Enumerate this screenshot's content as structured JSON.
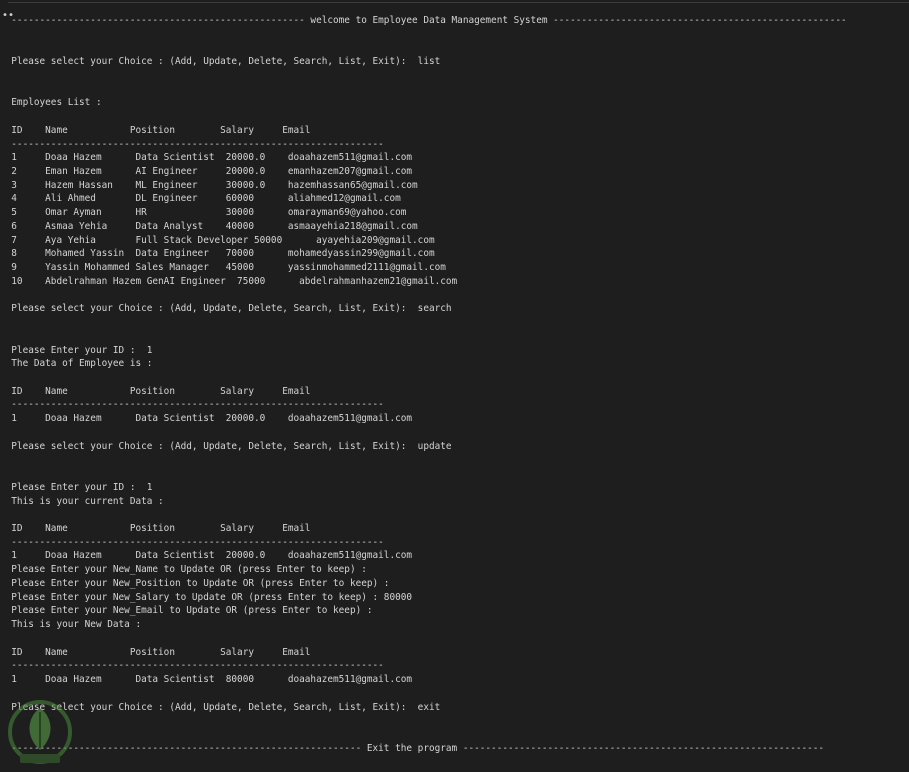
{
  "terminal": {
    "gutter_mark": "••",
    "lines": [
      "  ---------------------------------------------------- welcome to Employee Data Management System ----------------------------------------------------",
      "",
      "",
      "  Please select your Choice : (Add, Update, Delete, Search, List, Exit):  list",
      "",
      "",
      "  Employees List :",
      "",
      "  ID    Name           Position        Salary     Email",
      "  ------------------------------------------------------------------",
      "  1     Doaa Hazem      Data Scientist  20000.0    doaahazem511@gmail.com",
      "  2     Eman Hazem      AI Engineer     20000.0    emanhazem207@gmail.com",
      "  3     Hazem Hassan    ML Engineer     30000.0    hazemhassan65@gmail.com",
      "  4     Ali Ahmed       DL Engineer     60000      aliahmed12@gmail.com",
      "  5     Omar Ayman      HR              30000      omarayman69@yahoo.com",
      "  6     Asmaa Yehia     Data Analyst    40000      asmaayehia218@gmail.com",
      "  7     Aya Yehia       Full Stack Developer 50000      ayayehia209@gmail.com",
      "  8     Mohamed Yassin  Data Engineer   70000      mohamedyassin299@gmail.com",
      "  9     Yassin Mohammed Sales Manager   45000      yassinmohammed2111@gmail.com",
      "  10    Abdelrahman Hazem GenAI Engineer  75000      abdelrahmanhazem21@gmail.com",
      "",
      "  Please select your Choice : (Add, Update, Delete, Search, List, Exit):  search",
      "",
      "",
      "  Please Enter your ID :  1",
      "  The Data of Employee is :",
      "",
      "  ID    Name           Position        Salary     Email",
      "  ------------------------------------------------------------------",
      "  1     Doaa Hazem      Data Scientist  20000.0    doaahazem511@gmail.com",
      "",
      "  Please select your Choice : (Add, Update, Delete, Search, List, Exit):  update",
      "",
      "",
      "  Please Enter your ID :  1",
      "  This is your current Data :",
      "",
      "  ID    Name           Position        Salary     Email",
      "  ------------------------------------------------------------------",
      "  1     Doaa Hazem      Data Scientist  20000.0    doaahazem511@gmail.com",
      "  Please Enter your New_Name to Update OR (press Enter to keep) :",
      "  Please Enter your New_Position to Update OR (press Enter to keep) :",
      "  Please Enter your New_Salary to Update OR (press Enter to keep) : 80000",
      "  Please Enter your New_Email to Update OR (press Enter to keep) :",
      "  This is your New Data :",
      "",
      "  ID    Name           Position        Salary     Email",
      "  ------------------------------------------------------------------",
      "  1     Doaa Hazem      Data Scientist  80000      doaahazem511@gmail.com",
      "",
      "  Please select your Choice : (Add, Update, Delete, Search, List, Exit):  exit",
      "",
      "",
      "  -------------------------------------------------------------- Exit the program ----------------------------------------------------------------"
    ]
  },
  "colors": {
    "background": "#1e1e1e",
    "text": "#d4d4d4"
  },
  "watermark": {
    "icon": "leaf-circle-logo-icon",
    "text": "مستقل"
  }
}
